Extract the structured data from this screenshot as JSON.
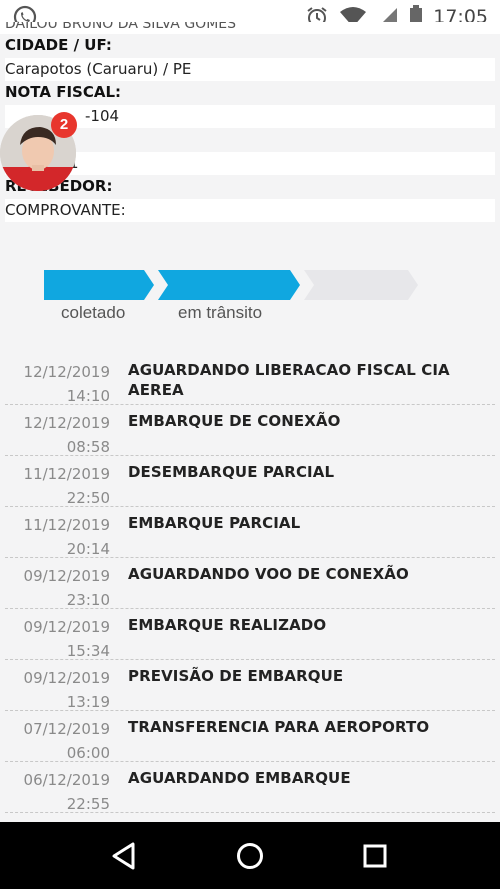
{
  "status_bar": {
    "time": "17:05",
    "icons": [
      "whatsapp-icon",
      "alarm-icon",
      "wifi-icon",
      "signal-icon",
      "battery-icon"
    ]
  },
  "info": {
    "top_cut_text": "DAILOU BRUNO DA SILVA GOMES",
    "cidade_label": "CIDADE / UF:",
    "cidade_value": "Carapotos (Caruaru) / PE",
    "nota_label": "NOTA FISCAL:",
    "nota_value": "-104",
    "hidden_value": "1",
    "recebedor_label": "RECEBEDOR:",
    "comprovante_label": "COMPROVANTE:"
  },
  "chat_head": {
    "badge_count": "2"
  },
  "progress": {
    "steps": [
      {
        "label": "coletado",
        "state": "done"
      },
      {
        "label": "em trânsito",
        "state": "active"
      },
      {
        "label": "",
        "state": "pending"
      }
    ],
    "colors": {
      "done": "#10a7e0",
      "pending": "#e7e7ea"
    }
  },
  "timeline": [
    {
      "date": "12/12/2019",
      "time": "14:10",
      "status": "AGUARDANDO LIBERACAO FISCAL CIA AEREA"
    },
    {
      "date": "12/12/2019",
      "time": "08:58",
      "status": "EMBARQUE DE CONEXÃO"
    },
    {
      "date": "11/12/2019",
      "time": "22:50",
      "status": "DESEMBARQUE PARCIAL"
    },
    {
      "date": "11/12/2019",
      "time": "20:14",
      "status": "EMBARQUE PARCIAL"
    },
    {
      "date": "09/12/2019",
      "time": "23:10",
      "status": "AGUARDANDO VOO DE CONEXÃO"
    },
    {
      "date": "09/12/2019",
      "time": "15:34",
      "status": "EMBARQUE REALIZADO"
    },
    {
      "date": "09/12/2019",
      "time": "13:19",
      "status": "PREVISÃO DE EMBARQUE"
    },
    {
      "date": "07/12/2019",
      "time": "06:00",
      "status": "TRANSFERENCIA PARA AEROPORTO"
    },
    {
      "date": "06/12/2019",
      "time": "22:55",
      "status": "AGUARDANDO EMBARQUE"
    }
  ],
  "nav_bar": {
    "buttons": [
      "back-icon",
      "home-icon",
      "recents-icon"
    ]
  }
}
